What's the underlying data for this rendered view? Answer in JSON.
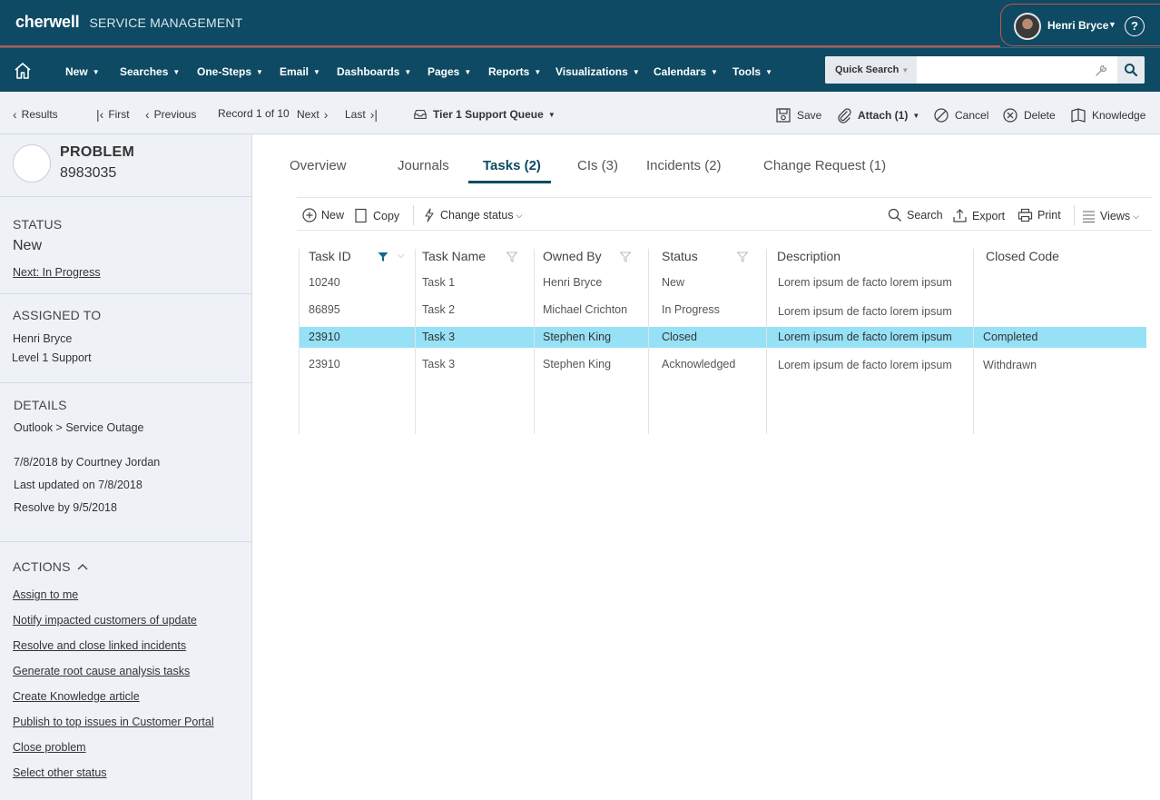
{
  "header": {
    "logo": "cherwell",
    "product": "SERVICE MANAGEMENT",
    "user_name": "Henri Bryce",
    "help_icon": "?"
  },
  "nav": {
    "items": [
      "New",
      "Searches",
      "One-Steps",
      "Email",
      "Dashboards",
      "Pages",
      "Reports",
      "Visualizations",
      "Calendars",
      "Tools"
    ],
    "quick_search_label": "Quick Search",
    "quick_search_value": ""
  },
  "toolbar": {
    "results": "Results",
    "first": "First",
    "previous": "Previous",
    "record": "Record 1 of 10",
    "next": "Next",
    "last": "Last",
    "queue": "Tier 1 Support Queue",
    "save": "Save",
    "attach": "Attach (1)",
    "cancel": "Cancel",
    "delete": "Delete",
    "knowledge": "Knowledge"
  },
  "left": {
    "type": "PROBLEM",
    "id": "8983035",
    "status_head": "STATUS",
    "status_value": "New",
    "next_link": "Next: In Progress",
    "assigned_head": "ASSIGNED TO",
    "assigned_name": "Henri Bryce",
    "assigned_group": "Level 1 Support",
    "details_head": "DETAILS",
    "details_category": "Outlook > Service Outage",
    "details_created": "7/8/2018 by Courtney Jordan",
    "details_updated": "Last updated on 7/8/2018",
    "details_resolve": "Resolve by 9/5/2018",
    "actions_head": "ACTIONS",
    "actions": [
      "Assign to me",
      "Notify impacted customers of update",
      "Resolve and close linked incidents",
      "Generate root cause analysis tasks",
      "Create Knowledge article",
      "Publish to top issues in Customer Portal",
      "Close problem",
      "Select other status"
    ]
  },
  "tabs": [
    "Overview",
    "Journals",
    "Tasks (2)",
    "CIs (3)",
    "Incidents (2)",
    "Change Request (1)"
  ],
  "grid_toolbar": {
    "new": "New",
    "copy": "Copy",
    "change_status": "Change status",
    "search": "Search",
    "export": "Export",
    "print": "Print",
    "views": "Views"
  },
  "table": {
    "columns": [
      "Task ID",
      "Task Name",
      "Owned By",
      "Status",
      "Description",
      "Closed Code"
    ],
    "rows": [
      [
        "10240",
        "Task 1",
        "Henri Bryce",
        "New",
        "Lorem ipsum de facto lorem ipsum",
        ""
      ],
      [
        "86895",
        "Task 2",
        "Michael Crichton",
        "In Progress",
        "Lorem ipsum de facto lorem ipsum",
        ""
      ],
      [
        "23910",
        "Task 3",
        "Stephen King",
        "Closed",
        "Lorem ipsum de facto lorem ipsum",
        "Completed"
      ],
      [
        "23910",
        "Task 3",
        "Stephen King",
        "Acknowledged",
        "Lorem ipsum de facto lorem ipsum",
        "Withdrawn"
      ]
    ],
    "selected_row_color": "#96e1f6"
  },
  "colors": {
    "brand": "#0e4a63",
    "accent_line": "#c0564b",
    "panel_bg": "#eef1f6"
  }
}
